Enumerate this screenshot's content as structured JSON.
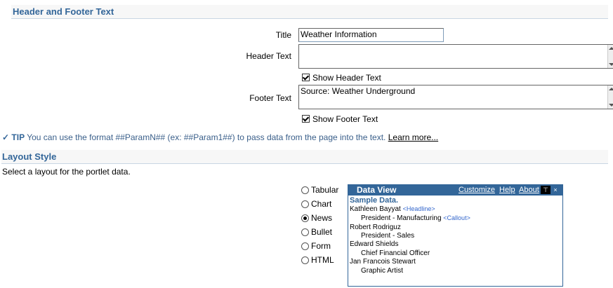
{
  "header_footer": {
    "section_title": "Header and Footer Text",
    "title_label": "Title",
    "title_value": "Weather Information",
    "header_label": "Header Text",
    "header_value": "",
    "show_header_label": "Show Header Text",
    "show_header_checked": true,
    "footer_label": "Footer Text",
    "footer_value": "Source: Weather Underground",
    "show_footer_label": "Show Footer Text",
    "show_footer_checked": true
  },
  "tip": {
    "label": "TIP",
    "text": "You can use the format ##ParamN## (ex: ##Param1##) to pass data from the page into the text.",
    "link": "Learn more..."
  },
  "layout": {
    "section_title": "Layout Style",
    "instruction": "Select a layout for the portlet data.",
    "options": [
      {
        "label": "Tabular",
        "selected": false
      },
      {
        "label": "Chart",
        "selected": false
      },
      {
        "label": "News",
        "selected": true
      },
      {
        "label": "Bullet",
        "selected": false
      },
      {
        "label": "Form",
        "selected": false
      },
      {
        "label": "HTML",
        "selected": false
      }
    ]
  },
  "data_view": {
    "title": "Data View",
    "links": [
      "Customize",
      "Help",
      "About"
    ],
    "sample_heading": "Sample Data.",
    "lines": [
      {
        "text": "Kathleen Bayyat",
        "tag": "<Headline>"
      },
      {
        "text": "President - Manufacturing",
        "tag": "<Callout>"
      },
      {
        "text": "Robert Rodriguz",
        "tag": ""
      },
      {
        "text": "President - Sales",
        "tag": ""
      },
      {
        "text": "Edward Shields",
        "tag": ""
      },
      {
        "text": "Chief Financial Officer",
        "tag": ""
      },
      {
        "text": "Jan Francois Stewart",
        "tag": ""
      },
      {
        "text": "Graphic Artist",
        "tag": ""
      }
    ]
  },
  "colors": {
    "accent": "#336699",
    "tag": "#3366cc"
  }
}
